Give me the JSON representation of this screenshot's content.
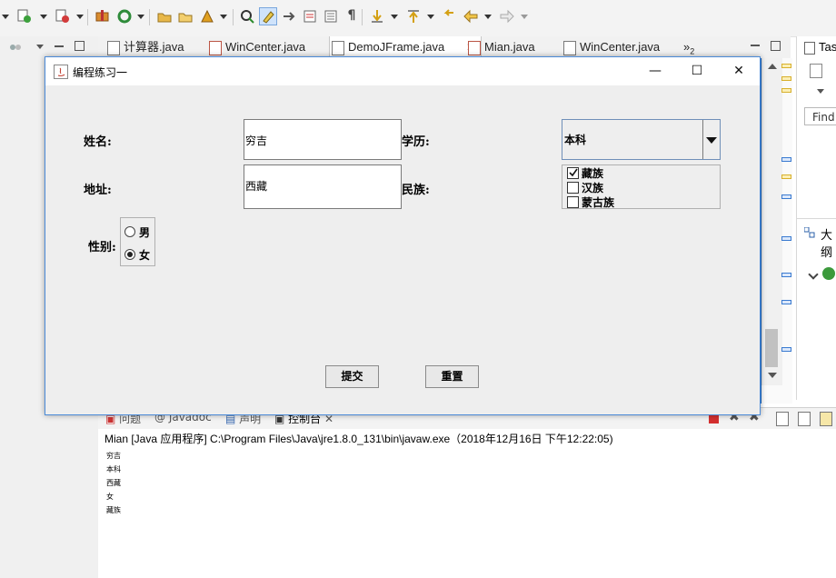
{
  "toolbar": {
    "buttons": [
      "new-java-icon",
      "run-icon",
      "debug-icon",
      "package-icon",
      "refresh-icon",
      "open-folder-icon",
      "open-icon",
      "deploy-icon",
      "search-icon",
      "highlight-icon",
      "toggle-icon",
      "show-whitespace-icon",
      "paragraph-icon",
      "next-annotation-icon",
      "prev-annotation-icon",
      "back-icon",
      "forward-icon"
    ]
  },
  "editor_tabs": {
    "tabs": [
      {
        "label": "计算器.java"
      },
      {
        "label": "WinCenter.java"
      },
      {
        "label": "DemoJFrame.java"
      },
      {
        "label": "Mian.java"
      },
      {
        "label": "WinCenter.java"
      }
    ],
    "overflow": "»",
    "overflow_count": "2"
  },
  "right_panel": {
    "tasks_label": "Tas",
    "find_placeholder": "Find",
    "outline_label": "大纲"
  },
  "dialog": {
    "title": "编程练习一",
    "window_buttons": {
      "minimize": "—",
      "maximize": "☐",
      "close": "✕"
    },
    "name_label": "姓名:",
    "name_value": "穷吉",
    "address_label": "地址:",
    "address_value": "西藏",
    "education_label": "学历:",
    "education_value": "本科",
    "ethnic_label": "民族:",
    "ethnic_options": [
      {
        "label": "藏族",
        "checked": true
      },
      {
        "label": "汉族",
        "checked": false
      },
      {
        "label": "蒙古族",
        "checked": false
      }
    ],
    "gender_label": "性别:",
    "gender_options": [
      {
        "label": "男",
        "selected": false
      },
      {
        "label": "女",
        "selected": true
      }
    ],
    "submit_label": "提交",
    "reset_label": "重置"
  },
  "console": {
    "tabs": [
      "问题",
      "@ Javadoc",
      "声明",
      "控制台"
    ],
    "header": "Mian [Java 应用程序] C:\\Program Files\\Java\\jre1.8.0_131\\bin\\javaw.exe（2018年12月16日 下午12:22:05)",
    "lines": [
      "穷吉",
      "本科",
      "西藏",
      "女",
      "藏族"
    ]
  },
  "colors": {
    "accent": "#1c6bc7",
    "dialog_border": "#4a8ad8",
    "dialog_bg": "#eeeeee"
  }
}
